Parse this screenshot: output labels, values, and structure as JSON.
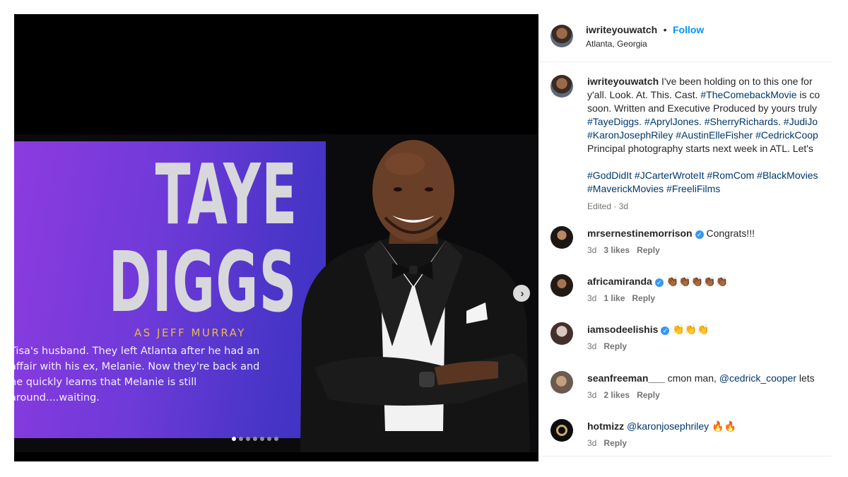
{
  "post": {
    "slide": {
      "name_line1": "TAYE",
      "name_line2": "DIGGS",
      "role": "AS JEFF MURRAY",
      "bio_lines": [
        "Tisa's husband. They left Atlanta after he had an",
        "affair with his ex, Melanie. Now they're back and",
        "he quickly learns that Melanie is still",
        "around....waiting."
      ]
    },
    "carousel": {
      "count": 7,
      "active_index": 0,
      "next_icon": "chevron-right-icon"
    }
  },
  "header": {
    "username": "iwriteyouwatch",
    "separator": "•",
    "follow_label": "Follow",
    "location": "Atlanta, Georgia"
  },
  "caption": {
    "username": "iwriteyouwatch",
    "line1": " I've been holding on to this one for",
    "line2_text": "y'all. Look. At. This. Cast. ",
    "line2_tag": "#TheComebackMovie",
    "line2_tail": " is co",
    "line3": "soon. Written and Executive Produced by yours truly",
    "line4_tags": "#TayeDiggs. #AprylJones. #SherryRichards. #JudiJo",
    "line5_tags": "#KaronJosephRiley #AustinElleFisher #CedrickCoop",
    "line6": "Principal photography starts next week in ATL. Let's",
    "line7_tags": "#GodDidIt #JCarterWroteIt #RomCom #BlackMovies",
    "line8_tags": "#MaverickMovies #FreeliFilms",
    "meta": "Edited · 3d"
  },
  "comments": [
    {
      "username": "mrsernestinemorrison",
      "verified": true,
      "text": " Congrats!!!",
      "time": "3d",
      "likes": "3 likes",
      "reply": "Reply"
    },
    {
      "username": "africamiranda",
      "verified": true,
      "text": " 👏🏾👏🏾👏🏾👏🏾👏🏾",
      "time": "3d",
      "likes": "1 like",
      "reply": "Reply"
    },
    {
      "username": "iamsodeelishis",
      "verified": true,
      "text": " 👏👏👏",
      "time": "3d",
      "likes": "",
      "reply": "Reply"
    },
    {
      "username": "seanfreeman___",
      "verified": false,
      "text": " cmon man, ",
      "mention": "@cedrick_cooper",
      "tail": " lets",
      "time": "3d",
      "likes": "2 likes",
      "reply": "Reply"
    },
    {
      "username": "hotmizz",
      "verified": false,
      "text": " ",
      "mention": "@karonjosephriley",
      "tail": " 🔥🔥",
      "time": "3d",
      "likes": "",
      "reply": "Reply"
    }
  ],
  "colors": {
    "accent": "#0095f6",
    "link": "#00376b",
    "muted": "#737373",
    "role_gold": "#e9b949"
  }
}
